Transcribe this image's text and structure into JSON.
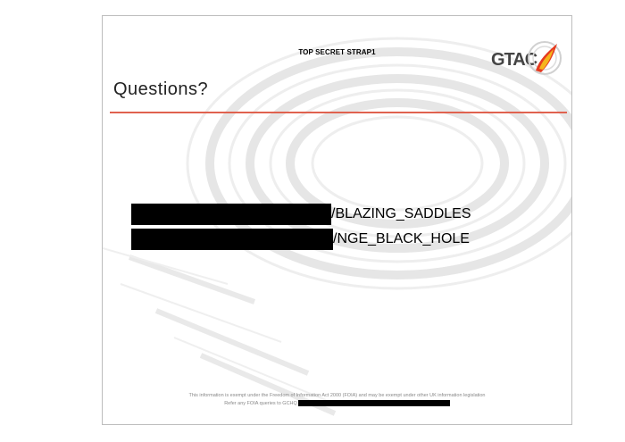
{
  "slide": {
    "classification": "TOP SECRET STRAP1",
    "logo_text": "GTAC",
    "title": "Questions?",
    "lines": [
      {
        "visible_text": "/BLAZING_SADDLES",
        "redacted": true
      },
      {
        "visible_text": "/NGE_BLACK_HOLE",
        "redacted": true
      }
    ],
    "footer_line1": "This information is exempt under the Freedom of Information Act 2000 (FOIA) and may be exempt under other UK information legislation",
    "footer_line2": "Refer any FOIA queries to GCHQ"
  },
  "colors": {
    "rule": "#e0624f",
    "logo_flame_outer": "#e63a1f",
    "logo_flame_inner": "#f5b51b",
    "redaction": "#000000"
  }
}
